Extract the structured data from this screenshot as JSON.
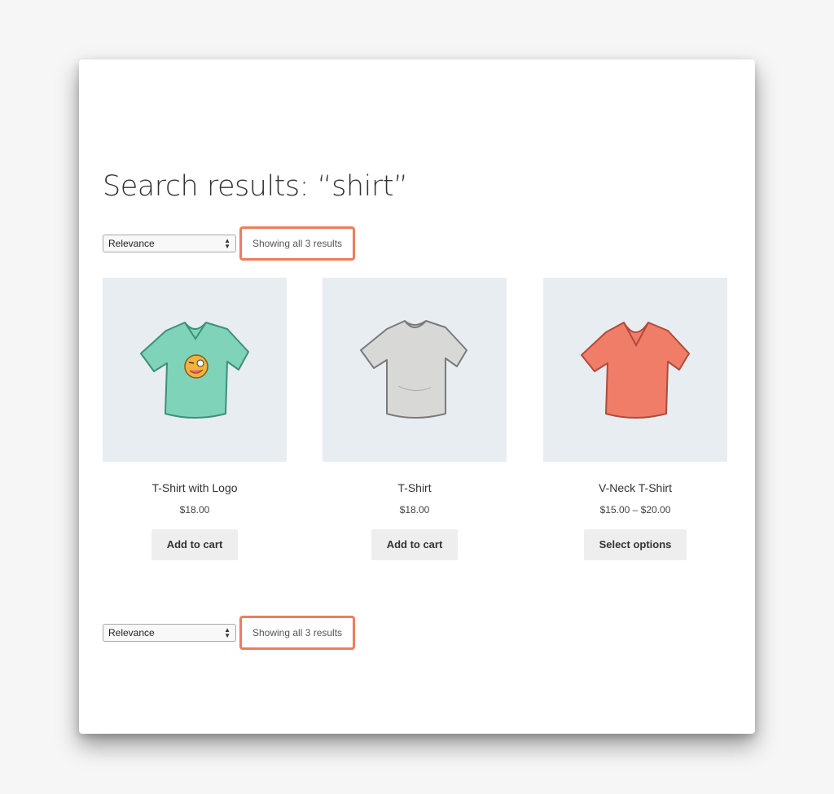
{
  "page": {
    "title": "Search results: “shirt”"
  },
  "ordering": {
    "selected": "Relevance",
    "result_count": "Showing all 3 results"
  },
  "products": [
    {
      "name": "T-Shirt with Logo",
      "price": "$18.00",
      "button": "Add to cart",
      "color": "#7fd3b8",
      "icon": "tshirt-logo-image"
    },
    {
      "name": "T-Shirt",
      "price": "$18.00",
      "button": "Add to cart",
      "color": "#d8d8d6",
      "icon": "tshirt-image"
    },
    {
      "name": "V-Neck T-Shirt",
      "price": "$15.00 – $20.00",
      "button": "Select options",
      "color": "#f07d68",
      "icon": "vneck-tshirt-image"
    }
  ],
  "colors": {
    "highlight": "#ef7c5d",
    "thumb_bg": "#e8edf2",
    "button_bg": "#eeeeee"
  }
}
